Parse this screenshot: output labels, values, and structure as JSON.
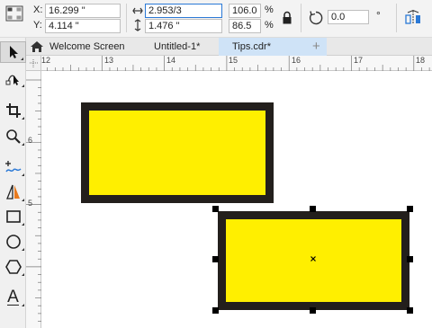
{
  "property_bar": {
    "x_label": "X:",
    "x_value": "16.299 \"",
    "y_label": "Y:",
    "y_value": "4.114 \"",
    "width_value": "2.953/3",
    "height_value": "1.476 \"",
    "scale_x": "106.0",
    "scale_y": "86.5",
    "percent_symbol": "%",
    "rotation_value": "0.0",
    "rotation_unit": "°"
  },
  "tabs": [
    {
      "label": "Welcome Screen"
    },
    {
      "label": "Untitled-1*"
    },
    {
      "label": "Tips.cdr*"
    }
  ],
  "new_tab_label": "+",
  "ruler": {
    "horizontal_ticks": [
      "12",
      "13",
      "14",
      "15",
      "16",
      "17",
      "18"
    ],
    "vertical_ticks": [
      "6",
      "5"
    ]
  },
  "toolbox": {
    "tools": [
      {
        "name": "pick-tool",
        "selected": true
      },
      {
        "name": "shape-tool"
      },
      {
        "name": "crop-tool"
      },
      {
        "name": "zoom-tool"
      },
      {
        "name": "freehand-tool"
      },
      {
        "name": "artistic-media-tool"
      },
      {
        "name": "rectangle-tool"
      },
      {
        "name": "ellipse-tool"
      },
      {
        "name": "polygon-tool"
      },
      {
        "name": "text-tool"
      }
    ],
    "text_tool_glyph": "A"
  },
  "colors": {
    "fill": "#ffef00",
    "outline": "#231f1c",
    "active_tab": "#cfe3f7",
    "active_field_border": "#2b79d6"
  }
}
